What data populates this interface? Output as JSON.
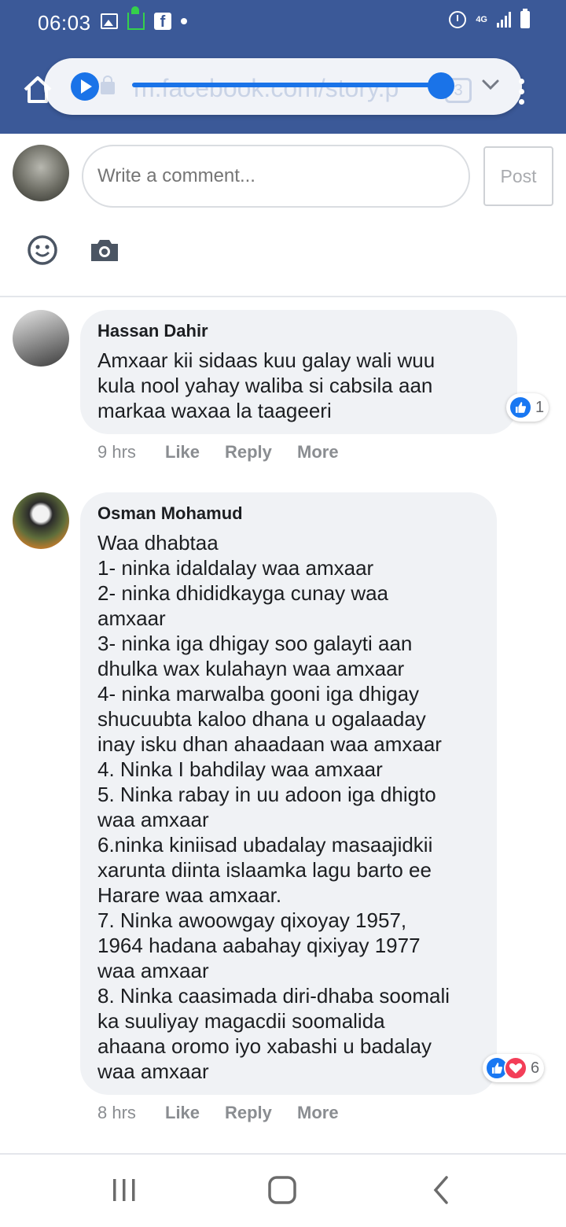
{
  "status_bar": {
    "time": "06:03",
    "network": "4G"
  },
  "browser": {
    "url": "m.facebook.com/story.p",
    "tab_count": "3",
    "media_progress": 0.9
  },
  "composer": {
    "placeholder": "Write a comment...",
    "post_label": "Post"
  },
  "comments": [
    {
      "author": "Hassan Dahir",
      "text": "Amxaar kii sidaas kuu galay wali wuu\nkula nool yahay waliba si cabsila aan\nmarkaa waxaa la taageeri",
      "time": "9 hrs",
      "like_label": "Like",
      "reply_label": "Reply",
      "more_label": "More",
      "reaction_count": "1",
      "reactions": [
        "like-icon"
      ]
    },
    {
      "author": "Osman Mohamud",
      "text": "Waa dhabtaa\n1- ninka idaldalay waa amxaar\n2- ninka dhididkayga cunay waa\namxaar\n3- ninka iga dhigay soo galayti aan\ndhulka wax kulahayn waa amxaar\n4- ninka marwalba gooni iga dhigay\nshucuubta kaloo dhana u ogalaaday\ninay isku dhan ahaadaan waa amxaar\n4. Ninka I bahdilay waa amxaar\n5. Ninka rabay in uu adoon iga dhigto\nwaa amxaar\n6.ninka kiniisad ubadalay masaajidkii\nxarunta diinta islaamka lagu barto ee\nHarare waa amxaar.\n7. Ninka awoowgay qixoyay 1957,\n1964 hadana aabahay qixiyay 1977\nwaa amxaar\n8. Ninka caasimada diri-dhaba soomali\nka suuliyay magacdii soomalida\nahaana oromo iyo xabashi u badalay\nwaa amxaar",
      "time": "8 hrs",
      "like_label": "Like",
      "reply_label": "Reply",
      "more_label": "More",
      "reaction_count": "6",
      "reactions": [
        "like-icon",
        "love-icon"
      ]
    }
  ],
  "colors": {
    "facebook_blue": "#3b5998",
    "accent_blue": "#1a73e8",
    "like_blue": "#1877f2",
    "love_red": "#f33e58",
    "bubble_bg": "#f0f2f5"
  }
}
